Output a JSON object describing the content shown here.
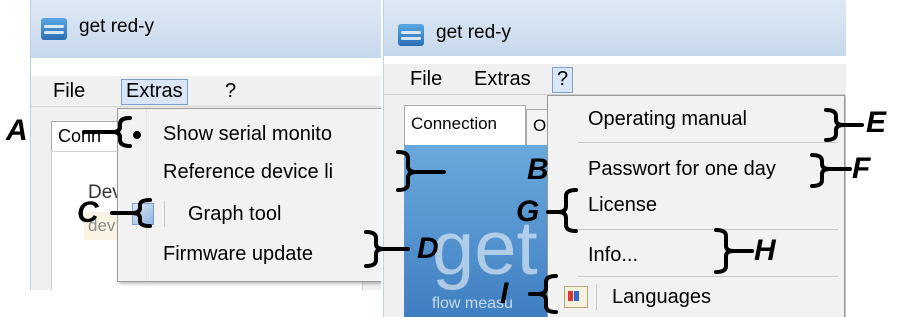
{
  "left_window": {
    "title": "get red-y",
    "menu": {
      "file": "File",
      "extras": "Extras",
      "help": "?"
    },
    "tab_fragment": "Conn",
    "group_fragment": "Dev",
    "field_fragment": "dev",
    "extras_menu": {
      "items": [
        {
          "label": "Show serial monito",
          "marker": "bullet"
        },
        {
          "label": "Reference device li"
        },
        {
          "label": "Graph tool",
          "icon": "graph-icon"
        },
        {
          "label": "Firmware update"
        }
      ]
    }
  },
  "right_window": {
    "title": "get red-y",
    "menu": {
      "file": "File",
      "extras": "Extras",
      "help": "?"
    },
    "tabs": {
      "active": "Connection",
      "next_fragment": "O"
    },
    "hero": {
      "big_text": "get",
      "small_text": "flow measu"
    },
    "help_menu": {
      "items": [
        {
          "label": "Operating manual"
        },
        {
          "label": "Passwort for one day"
        },
        {
          "label": "License"
        },
        {
          "label": "Info..."
        },
        {
          "label": "Languages",
          "icon": "languages-icon"
        }
      ]
    }
  },
  "callouts": {
    "A": "A",
    "B": "B",
    "C": "C",
    "D": "D",
    "E": "E",
    "F": "F",
    "G": "G",
    "H": "H",
    "I": "I"
  },
  "colors": {
    "menu_bg": "#f2f2f2",
    "titlebar": "#c7d8ec",
    "hero_blue": "#4f8fcf",
    "menu_open": "#dae6f5"
  }
}
